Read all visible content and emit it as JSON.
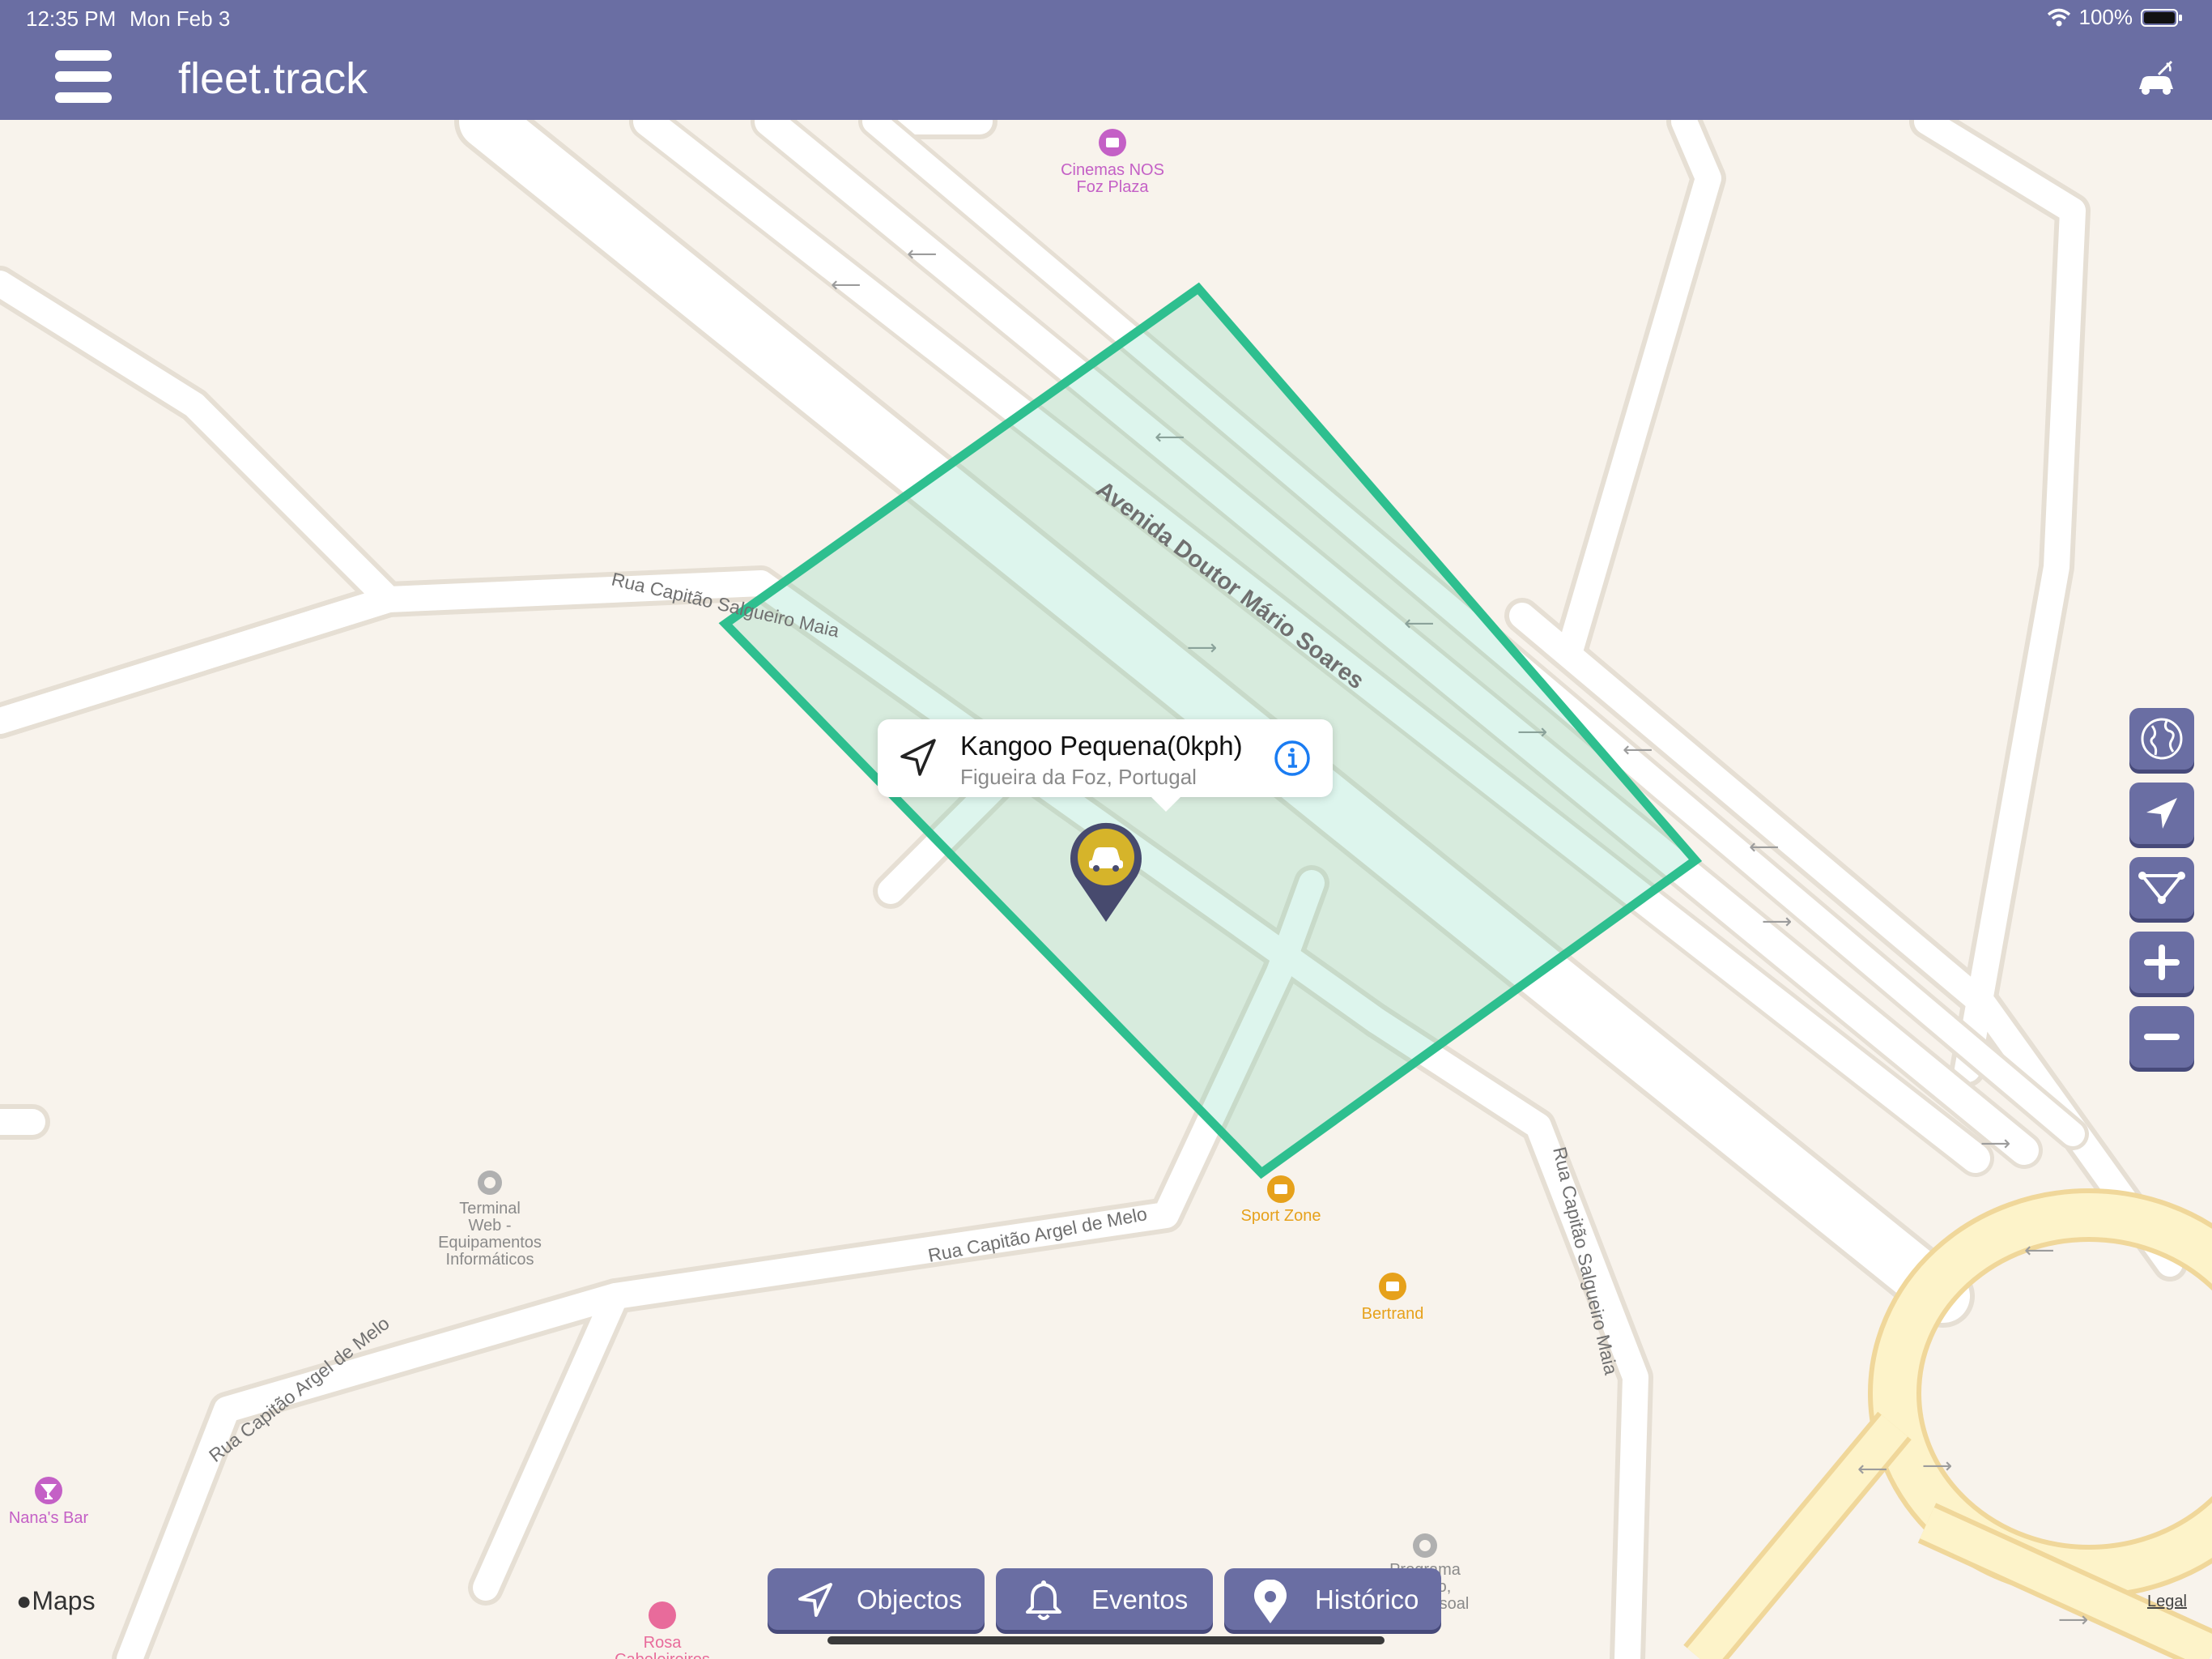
{
  "status_bar": {
    "time": "12:35 PM",
    "date": "Mon Feb 3",
    "battery": "100%"
  },
  "app": {
    "title": "fleet.track"
  },
  "map": {
    "street_labels": [
      "Avenida Doutor Mário Soares",
      "Rua Capitão Salgueiro Maia",
      "Rua Capitão Argel de Melo",
      "Rua Capitão Argel de Melo",
      "Rua Capitão Salgueiro Maia"
    ],
    "poi_labels": [
      {
        "line1": "Cinemas NOS",
        "line2": "Foz Plaza",
        "color": "#c460c6"
      },
      {
        "line1": "Terminal",
        "line2": "Web -",
        "line3": "Equipamentos",
        "line4": "Informáticos",
        "color": "#8a8a8a"
      },
      {
        "line1": "Sport Zone",
        "color": "#e6a11b"
      },
      {
        "line1": "Bertrand",
        "color": "#e6a11b"
      },
      {
        "line1": "Nana's Bar",
        "color": "#c460c6"
      },
      {
        "line1": "Rosa",
        "line2": "Cabeleireiros",
        "color": "#e86b9b"
      },
      {
        "line1": "Programa",
        "line2": "o,",
        "line3": "soal",
        "color": "#8a8a8a"
      }
    ],
    "geofence_color": "#2ebf8f",
    "attribution": "Maps",
    "legal": "Legal"
  },
  "vehicle": {
    "name": "Kangoo Pequena(0kph)",
    "location": "Figueira da Foz, Portugal"
  },
  "side_controls": [
    "globe-icon",
    "location-arrow-icon",
    "route-icon",
    "zoom-in-icon",
    "zoom-out-icon"
  ],
  "bottom_nav": [
    {
      "label": "Objectos",
      "icon": "navigation-arrow-icon"
    },
    {
      "label": "Eventos",
      "icon": "bell-icon"
    },
    {
      "label": "Histórico",
      "icon": "map-pin-icon"
    }
  ]
}
